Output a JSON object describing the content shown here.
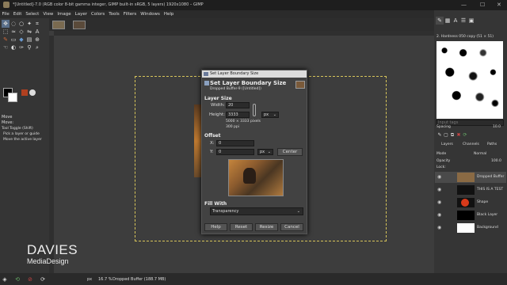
{
  "window": {
    "title": "*[Untitled]-7.0 (RGB color 8-bit gamma integer, GIMP built-in sRGB, 5 layers) 1920x1080 – GIMP",
    "minimize": "—",
    "maximize": "☐",
    "close": "✕"
  },
  "menu": [
    "File",
    "Edit",
    "Select",
    "View",
    "Image",
    "Layer",
    "Colors",
    "Tools",
    "Filters",
    "Windows",
    "Help"
  ],
  "toolbox": {
    "tool_name": "Move",
    "options_line": "Move:",
    "toggle_label": "Tool Toggle  (Shift)",
    "opt1": "Pick a layer or guide",
    "opt2": "Move the active layer"
  },
  "dialog": {
    "window_title": "Set Layer Boundary Size",
    "heading": "Set Layer Boundary Size",
    "subheading": "Dropped Buffer-9 ([Untitled])",
    "layer_size_label": "Layer Size",
    "width_label": "Width:",
    "width_value": "20",
    "height_label": "Height:",
    "height_value": "3333",
    "unit": "px",
    "size_info": "5000 × 3333 pixels",
    "ppi_info": "300 ppi",
    "offset_label": "Offset",
    "x_label": "X:",
    "x_value": "0",
    "y_label": "Y:",
    "y_value": "0",
    "offset_unit": "px",
    "center_button": "Center",
    "fill_label": "Fill With",
    "fill_value": "Transparency",
    "help_button": "Help",
    "reset_button": "Reset",
    "resize_button": "Resize",
    "cancel_button": "Cancel"
  },
  "brushes": {
    "brush_name": "2. Hardness 050 copy (51 × 51)",
    "filter_placeholder": "Input tags",
    "spacing_label": "Spacing",
    "spacing_value": "10.0"
  },
  "layers_panel": {
    "tabs": [
      "Layers",
      "Channels",
      "Paths"
    ],
    "mode_label": "Mode",
    "mode_value": "Normal",
    "opacity_label": "Opacity",
    "opacity_value": "100.0",
    "lock_label": "Lock:",
    "layers": [
      {
        "name": "Dropped Buffer",
        "color": "#8a6a44"
      },
      {
        "name": "THIS IS A TEST",
        "color": "#111111"
      },
      {
        "name": "Shape",
        "color": "#d83a1a"
      },
      {
        "name": "Black Layer",
        "color": "#000000"
      },
      {
        "name": "Background",
        "color": "#ffffff"
      }
    ]
  },
  "statusbar": {
    "unit": "px",
    "zoom": "16.7 %",
    "info": "Dropped Buffer (188.7 MB)"
  },
  "watermark": {
    "line1": "DAVIES",
    "line2": "MediaDesign"
  }
}
